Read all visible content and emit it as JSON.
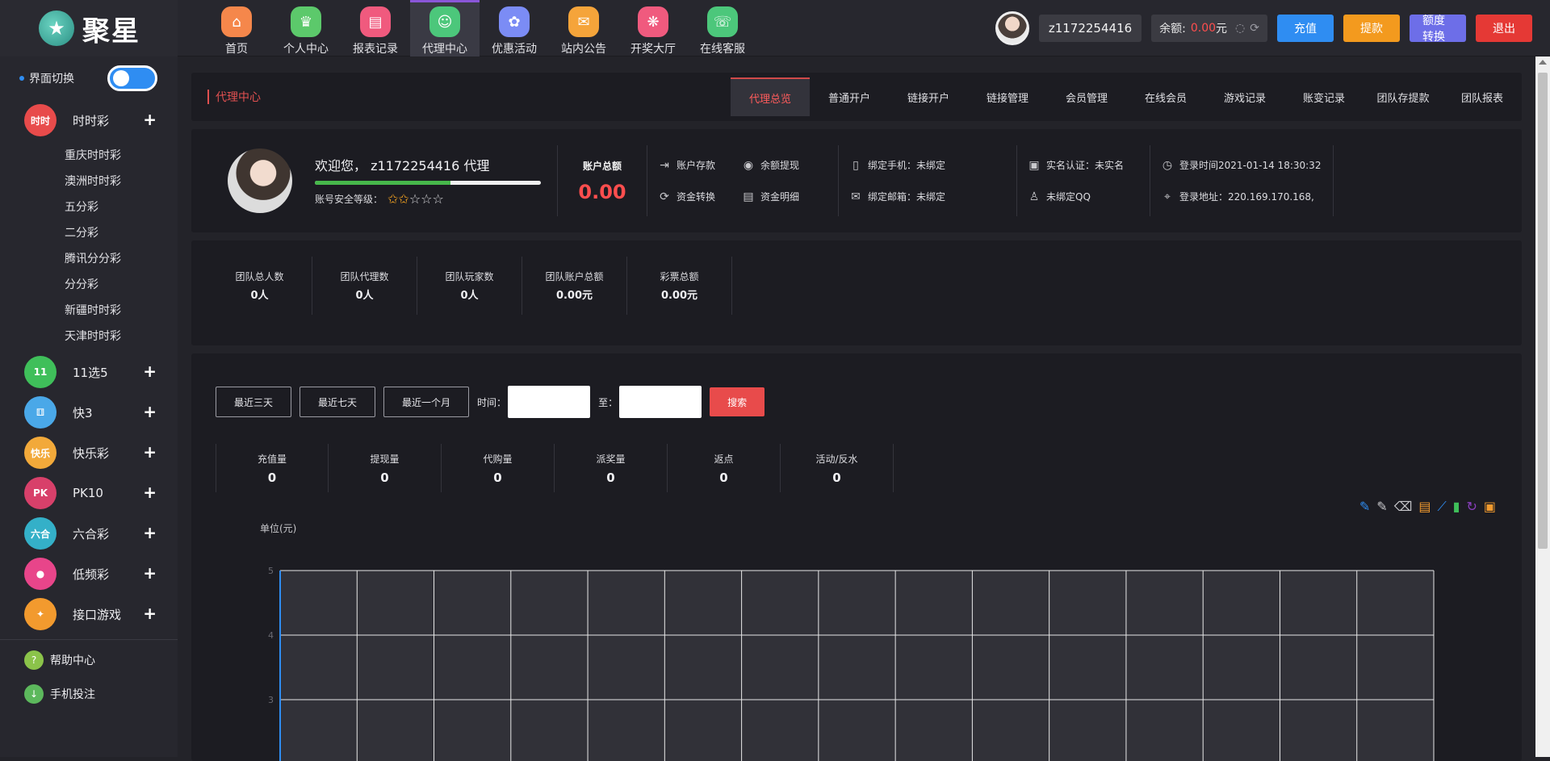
{
  "brand": {
    "logo_char": "★",
    "name": "聚星"
  },
  "nav": [
    {
      "label": "首页",
      "icon": "home-icon",
      "glyph": "⌂",
      "color": "#f5874b"
    },
    {
      "label": "个人中心",
      "icon": "crown-icon",
      "glyph": "♛",
      "color": "#5cc96b"
    },
    {
      "label": "报表记录",
      "icon": "report-icon",
      "glyph": "▤",
      "color": "#f05a7e"
    },
    {
      "label": "代理中心",
      "icon": "agent-icon",
      "glyph": "☺",
      "color": "#4cc77b",
      "active": true
    },
    {
      "label": "优惠活动",
      "icon": "gift-icon",
      "glyph": "✿",
      "color": "#7b8cf5"
    },
    {
      "label": "站内公告",
      "icon": "mail-icon",
      "glyph": "✉",
      "color": "#f5a43a"
    },
    {
      "label": "开奖大厅",
      "icon": "lottery-icon",
      "glyph": "❋",
      "color": "#f05a7e"
    },
    {
      "label": "在线客服",
      "icon": "service-icon",
      "glyph": "☏",
      "color": "#4cc77b"
    }
  ],
  "user": {
    "name": "z1172254416",
    "balance_label": "余额:",
    "balance_value": "0.00",
    "balance_unit": "元",
    "buttons": {
      "recharge": "充值",
      "withdraw": "提款",
      "transfer": "额度转换",
      "logout": "退出"
    }
  },
  "sidebar": {
    "switch_label": "界面切换",
    "categories": [
      {
        "label": "时时彩",
        "icon": "shishicai-icon",
        "glyph": "时时",
        "color": "#e84b4b",
        "expanded": true,
        "subs": [
          "重庆时时彩",
          "澳洲时时彩",
          "五分彩",
          "二分彩",
          "腾讯分分彩",
          "分分彩",
          "新疆时时彩",
          "天津时时彩"
        ]
      },
      {
        "label": "11选5",
        "icon": "11x5-icon",
        "glyph": "11",
        "color": "#3fbf5a"
      },
      {
        "label": "快3",
        "icon": "k3-icon",
        "glyph": "⚅",
        "color": "#4aa8e8"
      },
      {
        "label": "快乐彩",
        "icon": "kuailecai-icon",
        "glyph": "快乐",
        "color": "#f2a93a"
      },
      {
        "label": "PK10",
        "icon": "pk10-icon",
        "glyph": "PK",
        "color": "#d8406a"
      },
      {
        "label": "六合彩",
        "icon": "liuhecai-icon",
        "glyph": "六合",
        "color": "#34b0c8"
      },
      {
        "label": "低频彩",
        "icon": "dipincai-icon",
        "glyph": "●",
        "color": "#e8458a"
      },
      {
        "label": "接口游戏",
        "icon": "api-game-icon",
        "glyph": "✦",
        "color": "#f29a2e"
      }
    ],
    "links": [
      {
        "label": "帮助中心",
        "icon": "help-icon",
        "glyph": "?",
        "color": "#8bc34a"
      },
      {
        "label": "手机投注",
        "icon": "download-icon",
        "glyph": "↓",
        "color": "#5cb85c"
      }
    ]
  },
  "main": {
    "breadcrumb": "代理中心",
    "tabs": [
      "代理总览",
      "普通开户",
      "链接开户",
      "链接管理",
      "会员管理",
      "在线会员",
      "游戏记录",
      "账变记录",
      "团队存提款",
      "团队报表"
    ],
    "active_tab": 0,
    "profile": {
      "welcome": "欢迎您， z1172254416 代理",
      "security_label": "账号安全等级：",
      "security_progress": 0.6,
      "stars_on": 2,
      "stars_total": 5,
      "account_total_label": "账户总额",
      "account_total_value": "0.00",
      "quick_links": [
        {
          "label": "账户存款",
          "icon": "deposit-icon",
          "glyph": "⇥"
        },
        {
          "label": "余额提现",
          "icon": "withdraw-icon",
          "glyph": "◉"
        },
        {
          "label": "资金转换",
          "icon": "exchange-icon",
          "glyph": "⟳"
        },
        {
          "label": "资金明细",
          "icon": "detail-icon",
          "glyph": "▤"
        }
      ],
      "bind_info": [
        {
          "label": "绑定手机：未绑定",
          "icon": "phone-icon",
          "glyph": "▯"
        },
        {
          "label": "绑定邮箱：未绑定",
          "icon": "mail-icon",
          "glyph": "✉"
        }
      ],
      "auth_info": [
        {
          "label": "实名认证：未实名",
          "icon": "id-card-icon",
          "glyph": "▣"
        },
        {
          "label": "未绑定QQ",
          "icon": "qq-icon",
          "glyph": "♙"
        }
      ],
      "login_info": [
        {
          "label": "登录时间2021-01-14 18:30:32",
          "icon": "clock-icon",
          "glyph": "◷"
        },
        {
          "label": "登录地址：220.169.170.168,",
          "icon": "location-icon",
          "glyph": "⌖"
        }
      ]
    },
    "team_stats": [
      {
        "label": "团队总人数",
        "value": "0人"
      },
      {
        "label": "团队代理数",
        "value": "0人"
      },
      {
        "label": "团队玩家数",
        "value": "0人"
      },
      {
        "label": "团队账户总额",
        "value": "0.00元"
      },
      {
        "label": "彩票总额",
        "value": "0.00元"
      }
    ],
    "report": {
      "quick_ranges": [
        "最近三天",
        "最近七天",
        "最近一个月"
      ],
      "time_label": "时间：",
      "to_label": "至：",
      "start_value": "",
      "end_value": "",
      "search_label": "搜索",
      "stats": [
        {
          "label": "充值量",
          "value": "0"
        },
        {
          "label": "提现量",
          "value": "0"
        },
        {
          "label": "代购量",
          "value": "0"
        },
        {
          "label": "派奖量",
          "value": "0"
        },
        {
          "label": "返点",
          "value": "0"
        },
        {
          "label": "活动/反水",
          "value": "0"
        }
      ],
      "toolbox": [
        {
          "icon": "mark-icon",
          "glyph": "✎",
          "color": "#2f8df2"
        },
        {
          "icon": "mark-undo-icon",
          "glyph": "✎",
          "color": "#c8c8cc"
        },
        {
          "icon": "mark-clear-icon",
          "glyph": "⌫",
          "color": "#c8c8cc"
        },
        {
          "icon": "data-view-icon",
          "glyph": "▤",
          "color": "#f29a2e"
        },
        {
          "icon": "line-chart-icon",
          "glyph": "⟋",
          "color": "#2f8df2"
        },
        {
          "icon": "bar-chart-icon",
          "glyph": "▮",
          "color": "#3fbf5a"
        },
        {
          "icon": "restore-icon",
          "glyph": "↻",
          "color": "#8a3fbf"
        },
        {
          "icon": "save-image-icon",
          "glyph": "▣",
          "color": "#f29a2e"
        }
      ]
    }
  },
  "chart_data": {
    "type": "line",
    "title": "",
    "ylabel": "单位(元)",
    "xlabel": "",
    "y_ticks": [
      5,
      4,
      3
    ],
    "ylim": [
      0,
      5
    ],
    "x_divisions": 15,
    "series": [],
    "grid": true,
    "colors": {
      "axis": "#2f8df2",
      "grid": "#e8e8e8",
      "plot_bg": "#313138"
    }
  }
}
